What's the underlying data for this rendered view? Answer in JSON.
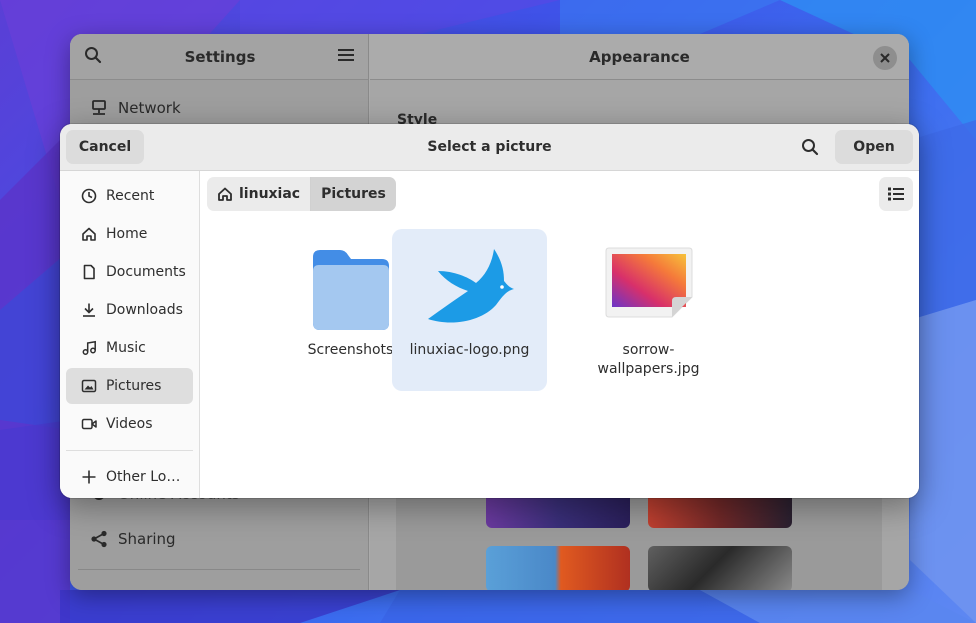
{
  "settings": {
    "title": "Settings",
    "panel_title": "Appearance",
    "style_label": "Style",
    "items": [
      {
        "label": "Network",
        "icon": "network-icon"
      },
      {
        "label": "Online Accounts",
        "icon": "online-accounts-icon"
      },
      {
        "label": "Sharing",
        "icon": "share-icon"
      }
    ]
  },
  "dialog": {
    "title": "Select a picture",
    "cancel_label": "Cancel",
    "open_label": "Open",
    "places": [
      {
        "label": "Recent",
        "icon": "clock-icon"
      },
      {
        "label": "Home",
        "icon": "home-icon"
      },
      {
        "label": "Documents",
        "icon": "document-icon"
      },
      {
        "label": "Downloads",
        "icon": "download-icon"
      },
      {
        "label": "Music",
        "icon": "music-icon"
      },
      {
        "label": "Pictures",
        "icon": "image-icon",
        "active": true
      },
      {
        "label": "Videos",
        "icon": "video-icon"
      }
    ],
    "other_locations": "Other Lo…",
    "path": [
      "linuxiac",
      "Pictures"
    ],
    "files": [
      {
        "name": "Screenshots",
        "type": "folder"
      },
      {
        "name": "linuxiac-logo.png",
        "type": "image",
        "selected": true
      },
      {
        "name": "sorrow-wallpapers.jpg",
        "type": "image"
      }
    ]
  },
  "colors": {
    "accent_blue": "#1c9be6",
    "folder": "#62a0ea",
    "selection": "#e3ecf9"
  }
}
